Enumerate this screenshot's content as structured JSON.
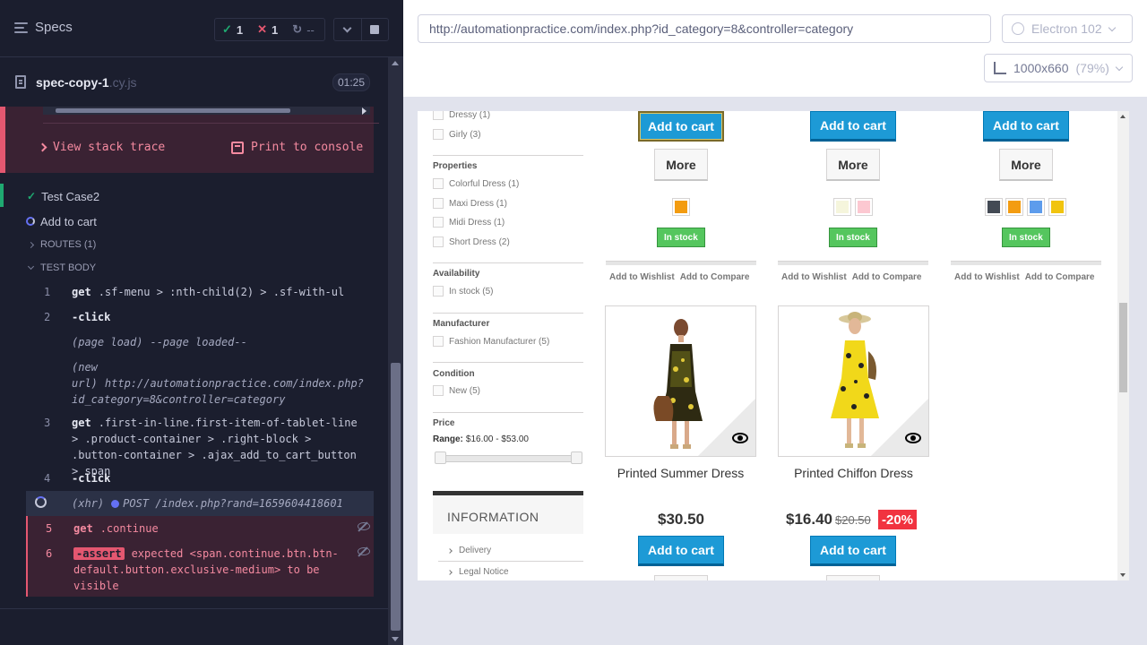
{
  "reporter": {
    "specs_label": "Specs",
    "stats": {
      "passed": "1",
      "failed": "1",
      "pending": "--"
    },
    "spec_name": "spec-copy-1",
    "spec_ext": ".cy.js",
    "duration": "01:25",
    "error_actions": {
      "stack_trace": "View stack trace",
      "print_console": "Print to console"
    },
    "tests": [
      {
        "title": "Test Case2",
        "state": "passed"
      },
      {
        "title": "Add to cart",
        "state": "running"
      }
    ],
    "routes_label": "ROUTES (1)",
    "test_body_label": "TEST BODY",
    "commands": [
      {
        "num": "1",
        "name": "get",
        "message": ".sf-menu > :nth-child(2) > .sf-with-ul"
      },
      {
        "num": "2",
        "name": "-click",
        "message": ""
      },
      {
        "num": "",
        "name": "(page load)",
        "message": "--page loaded--"
      },
      {
        "num": "",
        "name": "(new url)",
        "message": "http://automationpractice.com/index.php?id_category=8&controller=category"
      },
      {
        "num": "3",
        "name": "get",
        "message": ".first-in-line.first-item-of-tablet-line > .product-container > .right-block > .button-container > .ajax_add_to_cart_button > span"
      },
      {
        "num": "4",
        "name": "-click",
        "message": ""
      },
      {
        "num": "",
        "name": "(xhr)",
        "message": "POST /index.php?rand=1659604418601"
      },
      {
        "num": "5",
        "name": "get",
        "message": ".continue"
      },
      {
        "num": "6",
        "name": "-assert",
        "message": "expected <span.continue.btn.btn-default.button.exclusive-medium> to be visible"
      }
    ]
  },
  "aut": {
    "url": "http://automationpractice.com/index.php?id_category=8&controller=category",
    "browser": "Electron 102",
    "viewport": "1000x660",
    "scale": "(79%)"
  },
  "shop": {
    "filters": {
      "category_items": [
        "Dressy (1)",
        "Girly (3)"
      ],
      "properties_title": "Properties",
      "properties": [
        "Colorful Dress (1)",
        "Maxi Dress (1)",
        "Midi Dress (1)",
        "Short Dress (2)"
      ],
      "availability_title": "Availability",
      "availability": [
        "In stock (5)"
      ],
      "manufacturer_title": "Manufacturer",
      "manufacturer": [
        "Fashion Manufacturer (5)"
      ],
      "condition_title": "Condition",
      "condition": [
        "New (5)"
      ],
      "price_title": "Price",
      "range_label": "Range:",
      "range_value": "$16.00 - $53.00"
    },
    "information": {
      "title": "INFORMATION",
      "links": [
        "Delivery",
        "Legal Notice"
      ]
    },
    "buttons": {
      "add_to_cart": "Add to cart",
      "more": "More"
    },
    "stock_label": "In stock",
    "wishlist_label": "Add to Wishlist",
    "compare_label": "Add to Compare",
    "products_top": [
      {
        "swatches": [
          "#f39c11"
        ]
      },
      {
        "swatches": [
          "#f5f5dc",
          "#fcc8d1"
        ]
      },
      {
        "swatches": [
          "#434a54",
          "#f39c11",
          "#5d9cec",
          "#f1c40f"
        ]
      }
    ],
    "products": [
      {
        "name": "Printed Summer Dress",
        "price": "$30.50",
        "old_price": "",
        "reduction": ""
      },
      {
        "name": "Printed Chiffon Dress",
        "price": "$16.40",
        "old_price": "$20.50",
        "reduction": "-20%"
      }
    ]
  }
}
